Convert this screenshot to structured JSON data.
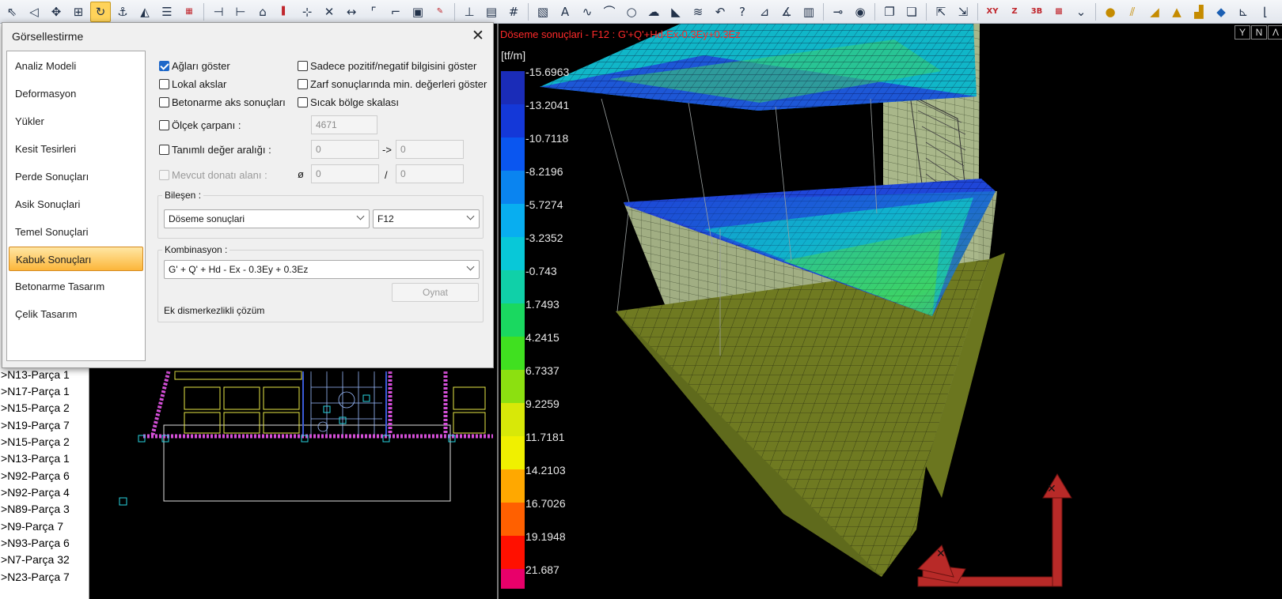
{
  "toolbar": {
    "icons": [
      "select-icon",
      "lasso-icon",
      "move-icon",
      "move-copy-icon",
      "rotate-icon",
      "anchor-icon",
      "mirror-icon",
      "align-icon",
      "grid-snap-icon",
      "extend-icon",
      "trim-icon",
      "offset-icon",
      "column-icon",
      "break-icon",
      "intersect-icon",
      "stretch-icon",
      "fillet-icon",
      "chamfer-icon",
      "region-icon",
      "brush-icon",
      "dimension-icon",
      "layer-icon",
      "table-grid-icon",
      "image-icon",
      "text-icon",
      "spline-icon",
      "arc-icon",
      "circle-icon",
      "cloud-icon",
      "hatch-icon",
      "zigzag-icon",
      "undo-arrow-icon",
      "query-icon",
      "chart-icon",
      "measure-icon",
      "report-icon",
      "beam-icon",
      "camera-icon",
      "window-copy-icon",
      "window-paste-icon",
      "export-icon",
      "scale-icon",
      "xy-axis-icon",
      "z-axis-icon",
      "3d-axis-icon",
      "render-icon",
      "dropdown-icon",
      "hand-icon",
      "draft-icon",
      "slope-icon",
      "triangle-icon",
      "tag-icon",
      "chart-axis-icon",
      "graph-icon",
      "axes-icon"
    ],
    "active_index": 4,
    "labels": {
      "xy": "XY",
      "z": "Z",
      "3d": "3B"
    }
  },
  "left_list": [
    "N13-Parça 1",
    "N17-Parça 1",
    "N15-Parça 2",
    "N19-Parça 7",
    "N15-Parça 2",
    "N13-Parça 1",
    "N92-Parça 6",
    "N92-Parça 4",
    "N89-Parça 3",
    "N9-Parça 7",
    "N93-Parça 6",
    "N7-Parça 32",
    "N23-Parça 7"
  ],
  "dialog": {
    "title": "Görsellestirme",
    "close_glyph": "✕",
    "nav": [
      "Analiz Modeli",
      "Deformasyon",
      "Yükler",
      "Kesit Tesirleri",
      "Perde Sonuçları",
      "Asik Sonuçlari",
      "Temel Sonuçlari",
      "Kabuk Sonuçları",
      "Betonarme Tasarım",
      "Çelik Tasarım"
    ],
    "nav_selected": 7,
    "options": {
      "show_mesh": {
        "label": "Ağları göster",
        "checked": true
      },
      "local_axes": {
        "label": "Lokal akslar",
        "checked": false
      },
      "rc_axis_results": {
        "label": "Betonarme aks sonuçları",
        "checked": false
      },
      "scale_factor": {
        "label": "Ölçek çarpanı :",
        "checked": false,
        "value": "4671"
      },
      "defined_range": {
        "label": "Tanımlı değer aralığı :",
        "checked": false,
        "from": "0",
        "arrow": "->",
        "to": "0"
      },
      "existing_rebar": {
        "label": "Mevcut donatı alanı :",
        "checked": false,
        "diameter_symbol": "ø",
        "dia": "0",
        "separator": "/",
        "spacing": "0"
      },
      "only_sign": {
        "label": "Sadece pozitif/negatif bilgisini göster",
        "checked": false
      },
      "envelope_min": {
        "label": "Zarf sonuçlarında min. değerleri göster",
        "checked": false
      },
      "heat_scale": {
        "label": "Sıcak bölge skalası",
        "checked": false
      }
    },
    "component": {
      "title": "Bileşen :",
      "type": "Döseme sonuçlari",
      "sub": "F12"
    },
    "combination": {
      "title": "Kombinasyon :",
      "value": "G' + Q' + Hd - Ex - 0.3Ey + 0.3Ez",
      "play_button": "Oynat",
      "note": "Ek dismerkezlikli çözüm"
    }
  },
  "view3d": {
    "title": "Döseme sonuçlari - F12 : G'+Q'+Hd-Ex-0.3Ey+0.3Ez",
    "unit": "[tf/m]",
    "tools": [
      "Y",
      "N",
      "Λ"
    ],
    "legend_values": [
      "-15.6963",
      "-13.2041",
      "-10.7118",
      "-8.2196",
      "-5.7274",
      "-3.2352",
      "-0.743",
      "1.7493",
      "4.2415",
      "6.7337",
      "9.2259",
      "11.7181",
      "14.2103",
      "16.7026",
      "19.1948",
      "21.687"
    ],
    "legend_colors": [
      "#1a2cb8",
      "#1438d8",
      "#0a56f0",
      "#0a84f0",
      "#08aef0",
      "#08c8d8",
      "#10d0a8",
      "#1ad860",
      "#40e020",
      "#8ce010",
      "#d8e808",
      "#f0f000",
      "#ffa800",
      "#ff6000",
      "#ff1000",
      "#e8006a"
    ]
  }
}
